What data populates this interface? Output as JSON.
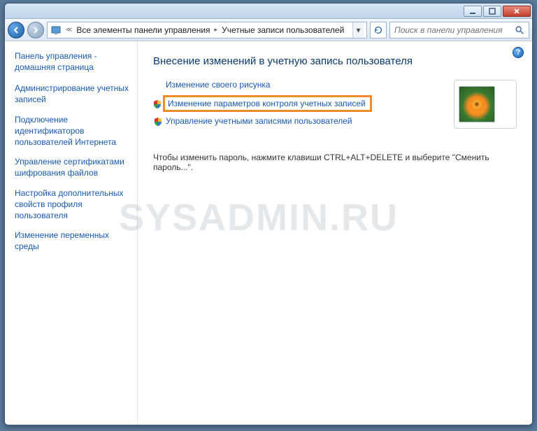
{
  "breadcrumb": {
    "segment1": "Все элементы панели управления",
    "segment2": "Учетные записи пользователей"
  },
  "search": {
    "placeholder": "Поиск в панели управления"
  },
  "sidebar": {
    "home": "Панель управления - домашняя страница",
    "links": [
      "Администрирование учетных записей",
      "Подключение идентификаторов пользователей Интернета",
      "Управление сертификатами шифрования файлов",
      "Настройка дополнительных свойств профиля пользователя",
      "Изменение переменных среды"
    ]
  },
  "main": {
    "heading": "Внесение изменений в учетную запись пользователя",
    "tasks": {
      "change_picture": "Изменение своего рисунка",
      "change_uac": "Изменение параметров контроля учетных записей",
      "manage_accounts": "Управление учетными записями пользователей"
    },
    "hint": "Чтобы изменить пароль, нажмите клавиши CTRL+ALT+DELETE и выберите \"Сменить пароль...\"."
  },
  "help": "?",
  "watermark": "SYSADMIN.RU"
}
